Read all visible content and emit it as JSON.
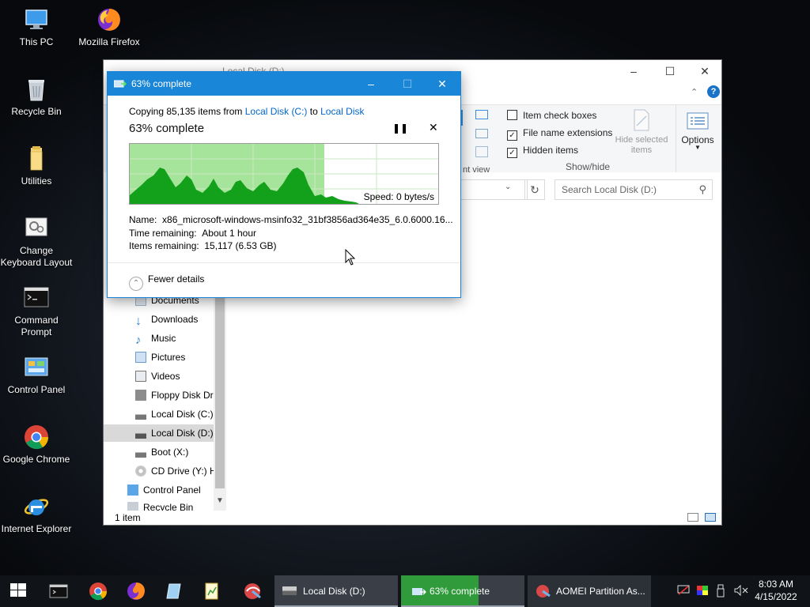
{
  "desktop": {
    "icons": [
      {
        "label": "This PC"
      },
      {
        "label": "Mozilla Firefox"
      },
      {
        "label": "Recycle Bin"
      },
      {
        "label": "Utilities"
      },
      {
        "label_line1": "Change",
        "label_line2": "Keyboard Layout"
      },
      {
        "label_line1": "Command",
        "label_line2": "Prompt"
      },
      {
        "label": "Control Panel"
      },
      {
        "label": "Google Chrome"
      },
      {
        "label": "Internet Explorer"
      }
    ]
  },
  "explorer": {
    "title": "Local Disk (D:)",
    "ribbon": {
      "item_check_boxes": "Item check boxes",
      "file_name_extensions": "File name extensions",
      "hidden_items": "Hidden items",
      "hide_selected_line1": "Hide selected",
      "hide_selected_line2": "items",
      "options": "Options",
      "show_hide": "Show/hide",
      "current_view_fragment": "nt view",
      "file_name_extensions_checked": true,
      "hidden_items_checked": true,
      "item_check_boxes_checked": false
    },
    "search_placeholder": "Search Local Disk (D:)",
    "nav": [
      {
        "label": "Documents"
      },
      {
        "label": "Downloads"
      },
      {
        "label": "Music"
      },
      {
        "label": "Pictures"
      },
      {
        "label": "Videos"
      },
      {
        "label": "Floppy Disk Dri"
      },
      {
        "label": "Local Disk (C:)"
      },
      {
        "label": "Local Disk (D:)"
      },
      {
        "label": "Boot (X:)"
      },
      {
        "label": "CD Drive (Y:) H"
      },
      {
        "label": "Control Panel"
      },
      {
        "label": "Recycle Bin"
      }
    ],
    "status": "1 item"
  },
  "copy_dialog": {
    "title": "63% complete",
    "copying_prefix": "Copying 85,135 items from ",
    "source": "Local Disk (C:)",
    "to_word": " to ",
    "destination": "Local Disk",
    "percent_text": "63% complete",
    "progress": 0.63,
    "speed": "Speed: 0 bytes/s",
    "name_label": "Name:",
    "name_value": "x86_microsoft-windows-msinfo32_31bf3856ad364e35_6.0.6000.16...",
    "time_label": "Time remaining:",
    "time_value": "About 1 hour",
    "items_label": "Items remaining:",
    "items_value": "15,117 (6.53 GB)",
    "fewer_details": "Fewer details"
  },
  "taskbar": {
    "buttons": [
      {
        "label": "Local Disk (D:)"
      },
      {
        "label": "63% complete",
        "progress": 0.63
      },
      {
        "label": "AOMEI Partition As..."
      }
    ],
    "clock_time": "8:03 AM",
    "clock_date": "4/15/2022"
  },
  "colors": {
    "accent": "#1a86d8",
    "progress_green": "#9ee48a",
    "graph_green": "#0fa41b"
  }
}
